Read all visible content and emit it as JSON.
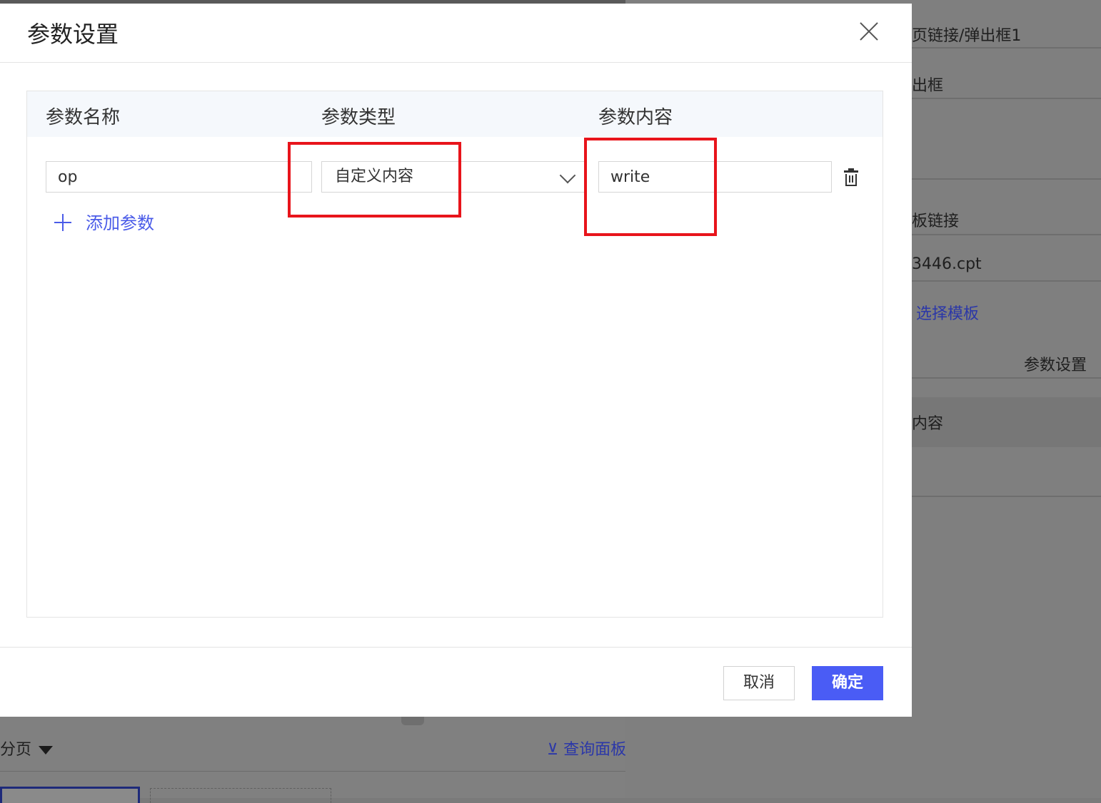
{
  "background": {
    "right_panel": {
      "popup_link_label": "页链接/弹出框1",
      "popup_label": "出框",
      "template_link_label": "板链接",
      "template_file": "3446.cpt",
      "choose_template_link": "选择模板",
      "param_settings_label": "参数设置",
      "content_label": "内容"
    },
    "bottom_bar": {
      "pagination_label": "分页",
      "query_panel_label": "查询面板"
    }
  },
  "dialog": {
    "title": "参数设置",
    "columns": {
      "name": "参数名称",
      "type": "参数类型",
      "content": "参数内容"
    },
    "rows": [
      {
        "name": "op",
        "type": "自定义内容",
        "value": "write"
      }
    ],
    "add_param_label": "添加参数",
    "cancel_label": "取消",
    "ok_label": "确定"
  },
  "colors": {
    "primary": "#4a5cf5",
    "link": "#4a5be8",
    "annotation": "#e8141b",
    "overlay": "#808080"
  }
}
